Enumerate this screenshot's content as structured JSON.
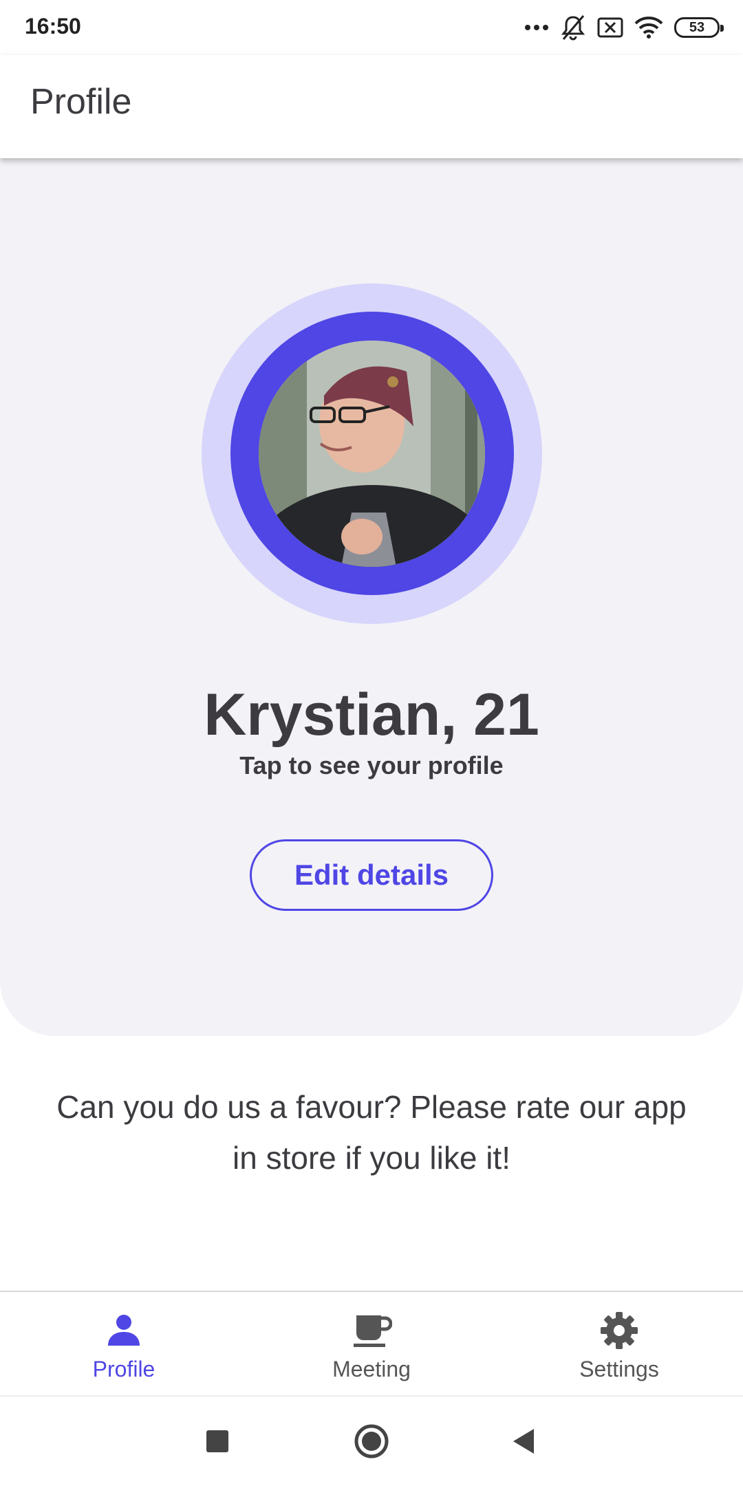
{
  "status_bar": {
    "time": "16:50",
    "battery_level": "53",
    "icons": [
      "more-dots-icon",
      "bell-off-icon",
      "sim-off-icon",
      "wifi-icon",
      "battery-icon"
    ]
  },
  "app_bar": {
    "title": "Profile"
  },
  "profile": {
    "name_age": "Krystian, 21",
    "subtitle": "Tap to see your profile",
    "edit_label": "Edit details"
  },
  "rate": {
    "message": "Can you do us a favour? Please rate our app in store if you like it!"
  },
  "bottom_nav": {
    "items": [
      {
        "label": "Profile",
        "icon": "person-icon",
        "active": true
      },
      {
        "label": "Meeting",
        "icon": "coffee-cup-icon",
        "active": false
      },
      {
        "label": "Settings",
        "icon": "gear-icon",
        "active": false
      }
    ]
  },
  "system_nav": {
    "icons": [
      "square-recents-icon",
      "circle-home-icon",
      "triangle-back-icon"
    ]
  },
  "colors": {
    "accent": "#4f46e5",
    "accent_light": "#d7d5fb",
    "card_background": "#f3f2f7",
    "text": "#3d3b40"
  }
}
